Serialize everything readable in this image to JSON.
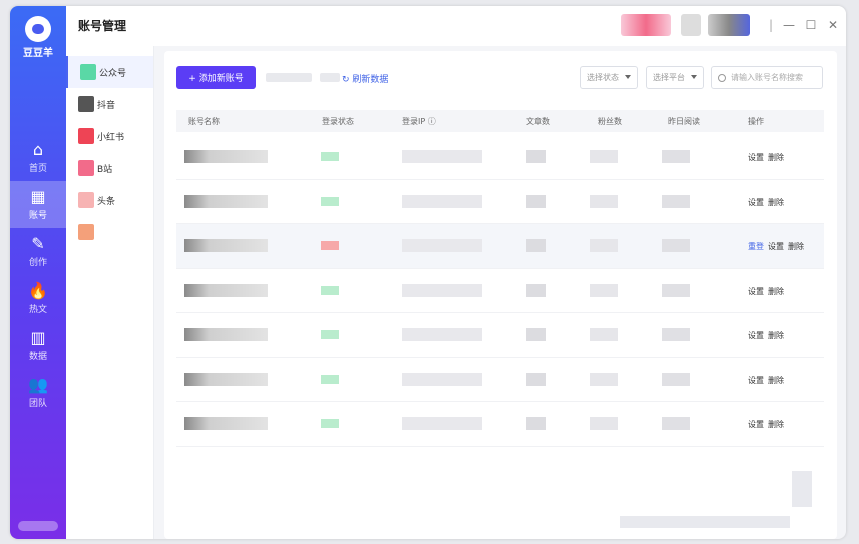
{
  "app": {
    "name": "豆豆羊"
  },
  "header": {
    "title": "账号管理"
  },
  "nav": [
    {
      "label": "首页",
      "icon": "home-icon",
      "glyph": "⌂",
      "active": false
    },
    {
      "label": "账号",
      "icon": "grid-icon",
      "glyph": "▦",
      "active": true
    },
    {
      "label": "创作",
      "icon": "pen-icon",
      "glyph": "✎",
      "active": false
    },
    {
      "label": "热文",
      "icon": "fire-icon",
      "glyph": "🔥",
      "active": false
    },
    {
      "label": "数据",
      "icon": "chart-icon",
      "glyph": "▥",
      "active": false
    },
    {
      "label": "团队",
      "icon": "team-icon",
      "glyph": "👥",
      "active": false
    }
  ],
  "platforms": [
    {
      "label": "公众号",
      "color": "#5ad8a6",
      "active": true
    },
    {
      "label": "抖音",
      "color": "#555555",
      "active": false
    },
    {
      "label": "小红书",
      "color": "#ee4455",
      "active": false
    },
    {
      "label": "B站",
      "color": "#f26b8a",
      "active": false
    },
    {
      "label": "头条",
      "color": "#f7b3b3",
      "active": false
    },
    {
      "label": "",
      "color": "#f4a07a",
      "active": false
    }
  ],
  "toolbar": {
    "add_label": "+ 添加新账号",
    "refresh_label": "刷新数据",
    "status_placeholder": "选择状态",
    "platform_placeholder": "选择平台",
    "search_placeholder": "请输入账号名称搜索"
  },
  "table": {
    "columns": [
      "账号名称",
      "登录状态",
      "登录IP ⓘ",
      "文章数",
      "粉丝数",
      "昨日阅读",
      "操作"
    ],
    "rows": [
      {
        "status_color": "#b9eccd",
        "ops": [
          "设置",
          "删除"
        ],
        "highlight": false
      },
      {
        "status_color": "#b9eccd",
        "ops": [
          "设置",
          "删除"
        ],
        "highlight": false
      },
      {
        "status_color": "#f6a9a9",
        "ops": [
          "重登",
          "设置",
          "删除"
        ],
        "highlight": true
      },
      {
        "status_color": "#b9eccd",
        "ops": [
          "设置",
          "删除"
        ],
        "highlight": false
      },
      {
        "status_color": "#b9eccd",
        "ops": [
          "设置",
          "删除"
        ],
        "highlight": false
      },
      {
        "status_color": "#b9eccd",
        "ops": [
          "设置",
          "删除"
        ],
        "highlight": false
      },
      {
        "status_color": "#b9eccd",
        "ops": [
          "设置",
          "删除"
        ],
        "highlight": false
      }
    ]
  },
  "colors": {
    "accent": "#5b3df5",
    "link": "#3f62e6"
  }
}
